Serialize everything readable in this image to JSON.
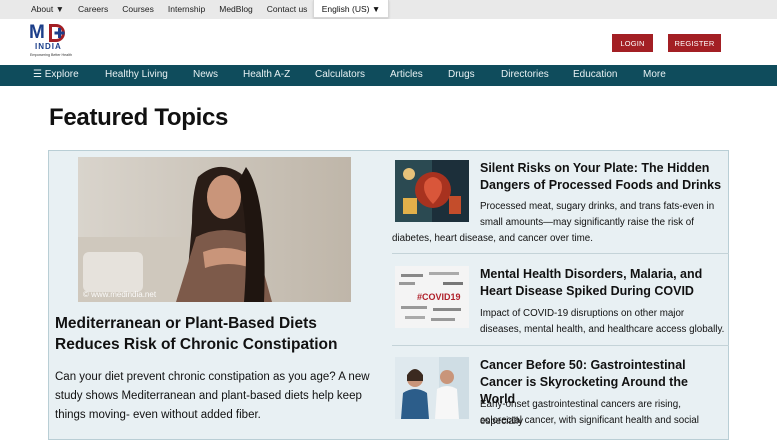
{
  "topbar": {
    "links": [
      "About ▼",
      "Careers",
      "Courses",
      "Internship",
      "MedBlog",
      "Contact us"
    ],
    "language": "English (US) ▼"
  },
  "header": {
    "logo_text": "MD INDIA",
    "logo_tagline": "Empowering Better Health",
    "login_label": "LOGIN",
    "register_label": "REGISTER"
  },
  "nav": {
    "items": [
      "☰ Explore",
      "Healthy Living",
      "News",
      "Health A-Z",
      "Calculators",
      "Articles",
      "Drugs",
      "Directories",
      "Education",
      "More"
    ]
  },
  "main": {
    "title": "Featured Topics",
    "featured": {
      "image_caption": "© www.medindia.net",
      "title": "Mediterranean or Plant-Based Diets Reduces Risk of Chronic Constipation",
      "description": "Can your diet prevent chronic constipation as you age? A new study shows Mediterranean and plant-based diets help keep things moving- even without added fiber."
    },
    "side_articles": [
      {
        "title": "Silent Risks on Your Plate: The Hidden Dangers of Processed Foods and Drinks",
        "desc_line1": "Processed meat, sugary drinks, and trans fats-even in",
        "desc_line2": "small amounts—may significantly raise the risk of",
        "desc_line3": "diabetes, heart disease, and cancer over time."
      },
      {
        "title": "Mental Health Disorders, Malaria, and Heart Disease Spiked During COVID",
        "thumb_text": "#COVID19",
        "desc_line1": "Impact of COVID-19 disruptions on other major",
        "desc_line2": "diseases, mental health, and healthcare access globally."
      },
      {
        "title": "Cancer Before 50: Gastrointestinal Cancer is Skyrocketing Around the World",
        "desc_line1": "Early-onset gastrointestinal cancers are rising, especially",
        "desc_line2": "colorectal cancer, with significant health and social"
      }
    ]
  },
  "colors": {
    "nav_bg": "#0f4c5c",
    "brand_red": "#a31f24",
    "logo_blue": "#1d3f8a",
    "panel_bg": "#e8f0f3"
  }
}
